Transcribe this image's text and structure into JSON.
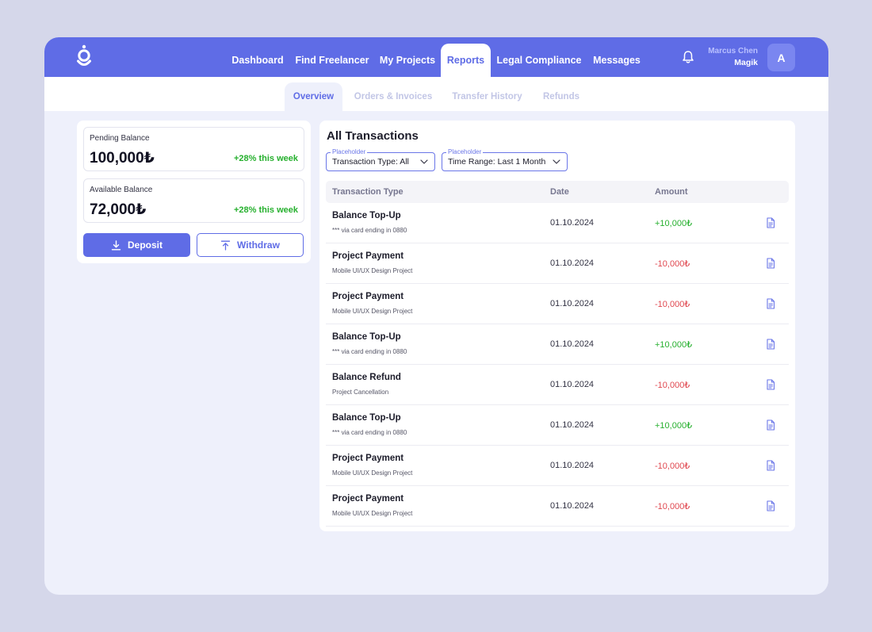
{
  "colors": {
    "brand": "#5f6ce6",
    "positive": "#26b02e",
    "negative": "#e0474f",
    "background": "#d5d7ea"
  },
  "nav": {
    "items": [
      {
        "label": "Dashboard"
      },
      {
        "label": "Find Freelancer"
      },
      {
        "label": "My Projects"
      },
      {
        "label": "Reports",
        "active": true
      },
      {
        "label": "Legal Compliance"
      },
      {
        "label": "Messages"
      }
    ]
  },
  "user": {
    "name": "Marcus Chen",
    "company": "Magik",
    "avatar_initial": "A"
  },
  "subtabs": [
    {
      "label": "Overview",
      "active": true
    },
    {
      "label": "Orders & Invoices"
    },
    {
      "label": "Transfer History"
    },
    {
      "label": "Refunds"
    }
  ],
  "balances": {
    "pending": {
      "label": "Pending Balance",
      "value": "100,000₺",
      "change": "+28% this week"
    },
    "available": {
      "label": "Available Balance",
      "value": "72,000₺",
      "change": "+28% this week"
    },
    "deposit_label": "Deposit",
    "withdraw_label": "Withdraw"
  },
  "transactions": {
    "title": "All Transactions",
    "filters": [
      {
        "placeholder": "Placeholder",
        "value": "Transaction Type: All"
      },
      {
        "placeholder": "Placeholder",
        "value": "Time Range: Last 1 Month"
      }
    ],
    "columns": [
      "Transaction Type",
      "Date",
      "Amount"
    ],
    "rows": [
      {
        "title": "Balance Top-Up",
        "sub": "*** via card ending in 0880",
        "date": "01.10.2024",
        "amount": "+10,000₺",
        "positive": true
      },
      {
        "title": "Project Payment",
        "sub": "Mobile UI/UX Design Project",
        "date": "01.10.2024",
        "amount": "-10,000₺",
        "positive": false
      },
      {
        "title": "Project Payment",
        "sub": "Mobile UI/UX Design Project",
        "date": "01.10.2024",
        "amount": "-10,000₺",
        "positive": false
      },
      {
        "title": "Balance Top-Up",
        "sub": "*** via card ending in 0880",
        "date": "01.10.2024",
        "amount": "+10,000₺",
        "positive": true
      },
      {
        "title": "Balance Refund",
        "sub": "Project Cancellation",
        "date": "01.10.2024",
        "amount": "-10,000₺",
        "positive": false
      },
      {
        "title": "Balance Top-Up",
        "sub": "*** via card ending in 0880",
        "date": "01.10.2024",
        "amount": "+10,000₺",
        "positive": true
      },
      {
        "title": "Project Payment",
        "sub": "Mobile UI/UX Design Project",
        "date": "01.10.2024",
        "amount": "-10,000₺",
        "positive": false
      },
      {
        "title": "Project Payment",
        "sub": "Mobile UI/UX Design Project",
        "date": "01.10.2024",
        "amount": "-10,000₺",
        "positive": false
      }
    ]
  }
}
